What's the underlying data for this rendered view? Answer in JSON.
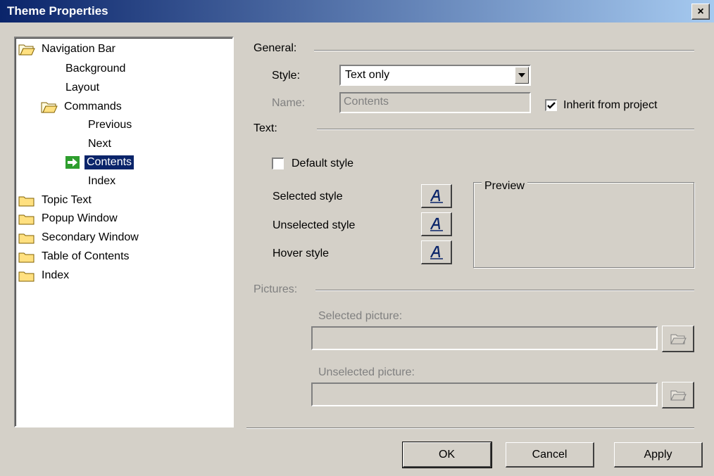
{
  "window": {
    "title": "Theme Properties",
    "close_glyph": "×"
  },
  "tree": {
    "items": [
      {
        "label": "Navigation Bar",
        "icon": "open-folder-icon"
      },
      {
        "label": "Background",
        "icon": ""
      },
      {
        "label": "Layout",
        "icon": ""
      },
      {
        "label": "Commands",
        "icon": "open-folder-icon"
      },
      {
        "label": "Previous",
        "icon": ""
      },
      {
        "label": "Next",
        "icon": ""
      },
      {
        "label": "Contents",
        "icon": "arrow-right-icon",
        "selected": true
      },
      {
        "label": "Index",
        "icon": ""
      },
      {
        "label": "Topic Text",
        "icon": "folder-icon"
      },
      {
        "label": "Popup Window",
        "icon": "folder-icon"
      },
      {
        "label": "Secondary Window",
        "icon": "folder-icon"
      },
      {
        "label": "Table of Contents",
        "icon": "folder-icon"
      },
      {
        "label": "Index",
        "icon": "folder-icon"
      }
    ]
  },
  "general": {
    "heading": "General:",
    "style_label": "Style:",
    "style_value": "Text only",
    "name_label": "Name:",
    "name_value": "Contents",
    "inherit_label": "Inherit from project",
    "inherit_checked": true
  },
  "text": {
    "heading": "Text:",
    "default_style_label": "Default style",
    "default_style_checked": false,
    "selected_style_label": "Selected style",
    "unselected_style_label": "Unselected style",
    "hover_style_label": "Hover style",
    "preview_label": "Preview"
  },
  "pictures": {
    "heading": "Pictures:",
    "selected_label": "Selected picture:",
    "selected_value": "",
    "unselected_label": "Unselected picture:",
    "unselected_value": ""
  },
  "buttons": {
    "ok": "OK",
    "cancel": "Cancel",
    "apply": "Apply"
  },
  "colors": {
    "titlebar_start": "#0a246a",
    "titlebar_end": "#a6caf0",
    "selection": "#0a246a",
    "face": "#d4d0c8",
    "font_icon": "#0a246a",
    "arrow_icon": "#2e9e2e"
  }
}
